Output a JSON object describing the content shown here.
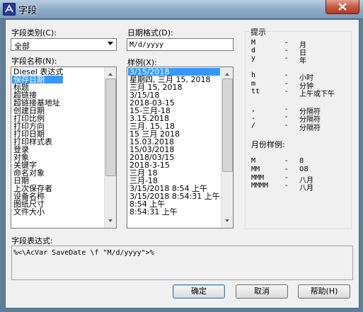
{
  "window": {
    "title": "字段",
    "close_icon": "close-icon",
    "app_icon": "autocad-icon"
  },
  "category": {
    "label": "字段类别(C):",
    "value": "全部"
  },
  "field_names": {
    "label": "字段名称(N):",
    "items": [
      "Diesel 表达式",
      "保存日期",
      "标题",
      "超链接",
      "超链接基地址",
      "创建日期",
      "打印比例",
      "打印方向",
      "打印日期",
      "打印样式表",
      "登录",
      "对象",
      "关键字",
      "命名对象",
      "日期",
      "上次保存者",
      "设备名称",
      "图纸尺寸",
      "文件大小"
    ],
    "selected_index": 1
  },
  "date_format": {
    "label": "日期格式(D):",
    "value": "M/d/yyyy"
  },
  "examples": {
    "label": "样例(X):",
    "items": [
      "3/15/2018",
      "星期四, 三月 15, 2018",
      "三月 15, 2018",
      "3/15/18",
      "2018-03-15",
      "15-三月-18",
      "3.15.2018",
      "三月. 15, 18",
      "15 三月 2018",
      "15.03.2018",
      "15/03/2018",
      "2018/03/15",
      "2018-3-15",
      "三月 18",
      "三月-18",
      "3/15/2018 8:54 上午",
      "3/15/2018 8:54:31 上午",
      "8:54 上午",
      "8:54:31 上午"
    ],
    "selected_index": 0
  },
  "hints": {
    "title": "提示",
    "rows": [
      {
        "key": "M",
        "dash": "-",
        "desc": "月"
      },
      {
        "key": "d",
        "dash": "-",
        "desc": "日"
      },
      {
        "key": "y",
        "dash": "-",
        "desc": "年"
      },
      {
        "key": "h",
        "dash": "-",
        "desc": "小时"
      },
      {
        "key": "m",
        "dash": "-",
        "desc": "分钟"
      },
      {
        "key": "tt",
        "dash": "-",
        "desc": "上午或下午"
      },
      {
        "key": ",",
        "dash": "-",
        "desc": "分隔符"
      },
      {
        "key": ".",
        "dash": "-",
        "desc": "分隔符"
      },
      {
        "key": "/",
        "dash": "-",
        "desc": "分隔符"
      }
    ],
    "month_title": "月份样例:",
    "month_rows": [
      {
        "key": "M",
        "dash": "-",
        "desc": "8"
      },
      {
        "key": "MM",
        "dash": "-",
        "desc": "08"
      },
      {
        "key": "MMM",
        "dash": "-",
        "desc": "八月"
      },
      {
        "key": "MMMM",
        "dash": "-",
        "desc": "八月"
      }
    ]
  },
  "expression": {
    "label": "字段表达式:",
    "value": "%<\\AcVar SaveDate \\f \"M/d/yyyy\">%"
  },
  "buttons": {
    "ok": "确定",
    "cancel": "取消",
    "help": "帮助(H)"
  },
  "colors": {
    "selection": "#3399ff",
    "titlebar": "#8aa9c6",
    "close": "#c85a44"
  }
}
